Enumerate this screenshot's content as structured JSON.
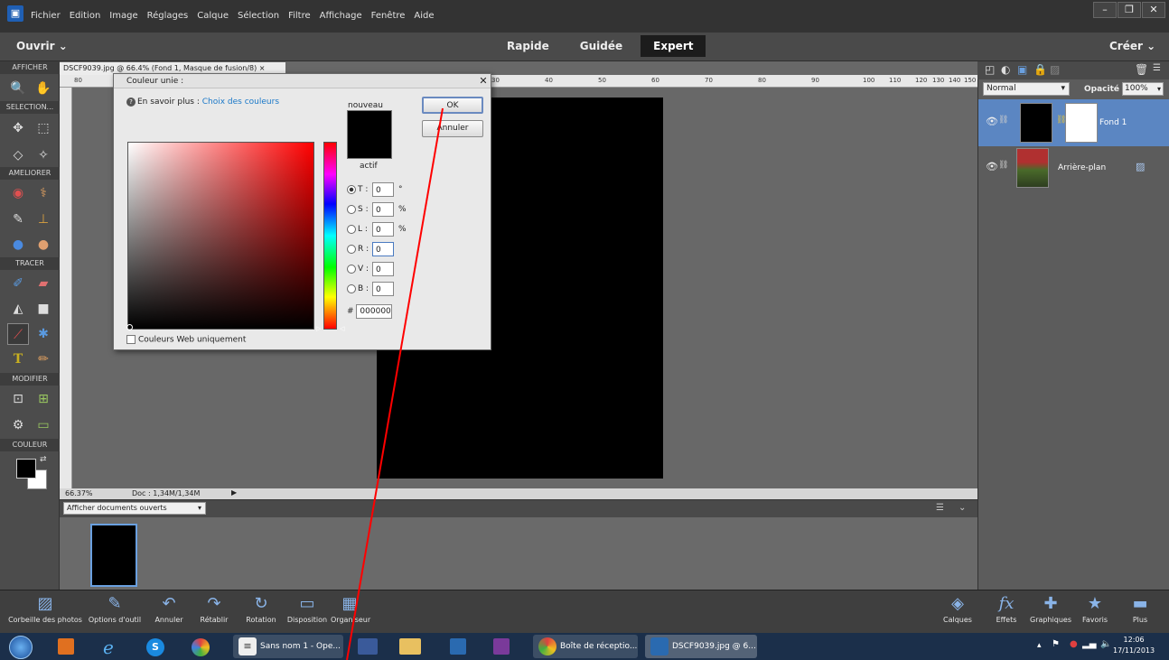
{
  "menubar": {
    "items": [
      "Fichier",
      "Edition",
      "Image",
      "Réglages",
      "Calque",
      "Sélection",
      "Filtre",
      "Affichage",
      "Fenêtre",
      "Aide"
    ]
  },
  "modebar": {
    "open_label": "Ouvrir",
    "modes": [
      "Rapide",
      "Guidée",
      "Expert"
    ],
    "active_mode": "Expert",
    "create_label": "Créer"
  },
  "toolbox": {
    "sections": [
      "AFFICHER",
      "SELECTION...",
      "AMELIORER",
      "TRACER",
      "MODIFIER",
      "COULEUR"
    ]
  },
  "document": {
    "tab_title": "DSCF9039.jpg @ 66.4% (Fond 1, Masque de fusion/8)",
    "ruler_ticks": [
      "80",
      "30",
      "40",
      "50",
      "60",
      "70",
      "80",
      "90",
      "100",
      "110",
      "120",
      "130",
      "140",
      "150"
    ],
    "zoom": "66.37%",
    "doc_info": "Doc : 1,34M/1,34M"
  },
  "photo_bin": {
    "select_value": "Afficher documents ouverts"
  },
  "layers_panel": {
    "blend_mode": "Normal",
    "opacity_label": "Opacité :",
    "opacity_value": "100%",
    "layers": [
      {
        "name": "Fond 1",
        "selected": true
      },
      {
        "name": "Arrière-plan",
        "selected": false
      }
    ]
  },
  "bottom_bar": {
    "left_buttons": [
      "Corbeille des photos",
      "Options d'outil",
      "Annuler",
      "Rétablir",
      "Rotation",
      "Disposition",
      "Organiseur"
    ],
    "right_buttons": [
      "Calques",
      "Effets",
      "Graphiques",
      "Favoris",
      "Plus"
    ]
  },
  "dialog": {
    "title": "Couleur unie :",
    "learn_prefix": "En savoir plus :",
    "learn_link": "Choix des couleurs",
    "new_label": "nouveau",
    "active_label": "actif",
    "ok_label": "OK",
    "cancel_label": "Annuler",
    "fields": [
      {
        "label": "T :",
        "value": "0",
        "unit": "°"
      },
      {
        "label": "S :",
        "value": "0",
        "unit": "%"
      },
      {
        "label": "L :",
        "value": "0",
        "unit": "%"
      },
      {
        "label": "R :",
        "value": "0",
        "unit": ""
      },
      {
        "label": "V :",
        "value": "0",
        "unit": ""
      },
      {
        "label": "B :",
        "value": "0",
        "unit": ""
      }
    ],
    "hex_value": "000000",
    "web_only_label": "Couleurs Web uniquement"
  },
  "taskbar": {
    "tasks": [
      "Sans nom 1 - Ope...",
      "Boîte de réceptio...",
      "DSCF9039.jpg @ 6..."
    ],
    "time": "12:06",
    "date": "17/11/2013"
  },
  "colors": {
    "accent": "#1a78c8",
    "layer_selected": "#5b86c2",
    "annotation_line": "#ff0000"
  }
}
